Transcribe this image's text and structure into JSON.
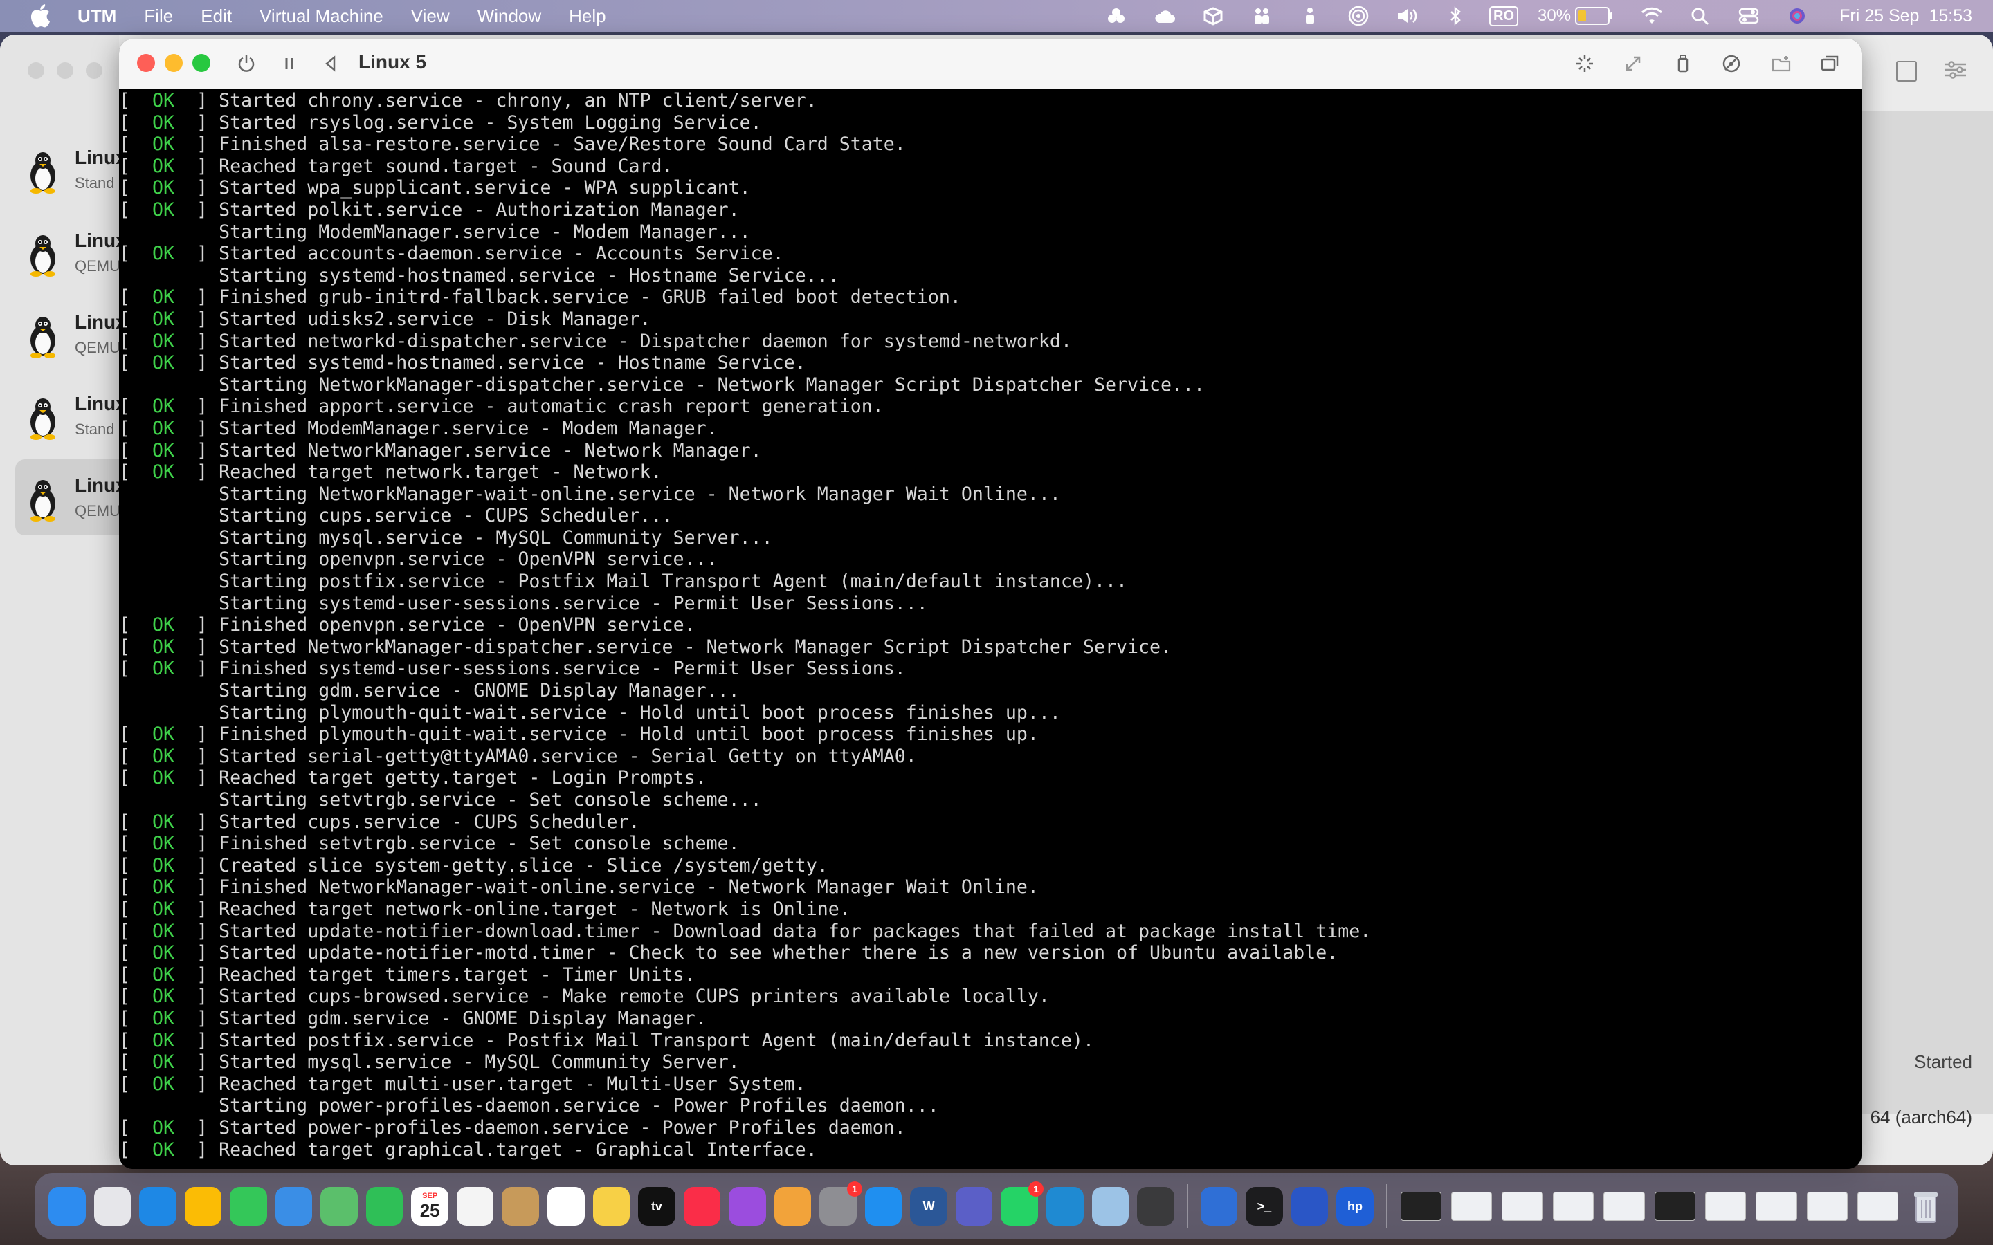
{
  "menubar": {
    "apple_icon": "apple-icon",
    "app_name": "UTM",
    "menus": [
      "File",
      "Edit",
      "Virtual Machine",
      "View",
      "Window",
      "Help"
    ],
    "input_source": "RO",
    "battery_percent": "30%",
    "battery_level": 0.3,
    "date": "Fri 25 Sep",
    "time": "15:53"
  },
  "library": {
    "vms": [
      {
        "name": "Linux",
        "subtitle": "Stand"
      },
      {
        "name": "Linux",
        "subtitle": "QEMU"
      },
      {
        "name": "Linux",
        "subtitle": "QEMU"
      },
      {
        "name": "Linux",
        "subtitle": "Stand"
      },
      {
        "name": "Linux",
        "subtitle": "QEMU"
      }
    ],
    "selected_index": 4,
    "status": "Started",
    "arch": "64 (aarch64)"
  },
  "vm_window": {
    "title": "Linux 5",
    "toolbar_icons": [
      "power-icon",
      "pause-icon",
      "back-icon",
      "capture-input-icon",
      "resize-icon",
      "usb-icon",
      "drive-icon",
      "shared-folder-icon",
      "windows-icon"
    ]
  },
  "console": {
    "lines": [
      {
        "ok": true,
        "text": "Started chrony.service - chrony, an NTP client/server."
      },
      {
        "ok": true,
        "text": "Started rsyslog.service - System Logging Service."
      },
      {
        "ok": true,
        "text": "Finished alsa-restore.service - Save/Restore Sound Card State."
      },
      {
        "ok": true,
        "text": "Reached target sound.target - Sound Card."
      },
      {
        "ok": true,
        "text": "Started wpa_supplicant.service - WPA supplicant."
      },
      {
        "ok": true,
        "text": "Started polkit.service - Authorization Manager."
      },
      {
        "ok": false,
        "text": "Starting ModemManager.service - Modem Manager..."
      },
      {
        "ok": true,
        "text": "Started accounts-daemon.service - Accounts Service."
      },
      {
        "ok": false,
        "text": "Starting systemd-hostnamed.service - Hostname Service..."
      },
      {
        "ok": true,
        "text": "Finished grub-initrd-fallback.service - GRUB failed boot detection."
      },
      {
        "ok": true,
        "text": "Started udisks2.service - Disk Manager."
      },
      {
        "ok": true,
        "text": "Started networkd-dispatcher.service - Dispatcher daemon for systemd-networkd."
      },
      {
        "ok": true,
        "text": "Started systemd-hostnamed.service - Hostname Service."
      },
      {
        "ok": false,
        "text": "Starting NetworkManager-dispatcher.service - Network Manager Script Dispatcher Service..."
      },
      {
        "ok": true,
        "text": "Finished apport.service - automatic crash report generation."
      },
      {
        "ok": true,
        "text": "Started ModemManager.service - Modem Manager."
      },
      {
        "ok": true,
        "text": "Started NetworkManager.service - Network Manager."
      },
      {
        "ok": true,
        "text": "Reached target network.target - Network."
      },
      {
        "ok": false,
        "text": "Starting NetworkManager-wait-online.service - Network Manager Wait Online..."
      },
      {
        "ok": false,
        "text": "Starting cups.service - CUPS Scheduler..."
      },
      {
        "ok": false,
        "text": "Starting mysql.service - MySQL Community Server..."
      },
      {
        "ok": false,
        "text": "Starting openvpn.service - OpenVPN service..."
      },
      {
        "ok": false,
        "text": "Starting postfix.service - Postfix Mail Transport Agent (main/default instance)..."
      },
      {
        "ok": false,
        "text": "Starting systemd-user-sessions.service - Permit User Sessions..."
      },
      {
        "ok": true,
        "text": "Finished openvpn.service - OpenVPN service."
      },
      {
        "ok": true,
        "text": "Started NetworkManager-dispatcher.service - Network Manager Script Dispatcher Service."
      },
      {
        "ok": true,
        "text": "Finished systemd-user-sessions.service - Permit User Sessions."
      },
      {
        "ok": false,
        "text": "Starting gdm.service - GNOME Display Manager..."
      },
      {
        "ok": false,
        "text": "Starting plymouth-quit-wait.service - Hold until boot process finishes up..."
      },
      {
        "ok": true,
        "text": "Finished plymouth-quit-wait.service - Hold until boot process finishes up."
      },
      {
        "ok": true,
        "text": "Started serial-getty@ttyAMA0.service - Serial Getty on ttyAMA0."
      },
      {
        "ok": true,
        "text": "Reached target getty.target - Login Prompts."
      },
      {
        "ok": false,
        "text": "Starting setvtrgb.service - Set console scheme..."
      },
      {
        "ok": true,
        "text": "Started cups.service - CUPS Scheduler."
      },
      {
        "ok": true,
        "text": "Finished setvtrgb.service - Set console scheme."
      },
      {
        "ok": true,
        "text": "Created slice system-getty.slice - Slice /system/getty."
      },
      {
        "ok": true,
        "text": "Finished NetworkManager-wait-online.service - Network Manager Wait Online."
      },
      {
        "ok": true,
        "text": "Reached target network-online.target - Network is Online."
      },
      {
        "ok": true,
        "text": "Started update-notifier-download.timer - Download data for packages that failed at package install time."
      },
      {
        "ok": true,
        "text": "Started update-notifier-motd.timer - Check to see whether there is a new version of Ubuntu available."
      },
      {
        "ok": true,
        "text": "Reached target timers.target - Timer Units."
      },
      {
        "ok": true,
        "text": "Started cups-browsed.service - Make remote CUPS printers available locally."
      },
      {
        "ok": true,
        "text": "Started gdm.service - GNOME Display Manager."
      },
      {
        "ok": true,
        "text": "Started postfix.service - Postfix Mail Transport Agent (main/default instance)."
      },
      {
        "ok": true,
        "text": "Started mysql.service - MySQL Community Server."
      },
      {
        "ok": true,
        "text": "Reached target multi-user.target - Multi-User System."
      },
      {
        "ok": false,
        "text": "Starting power-profiles-daemon.service - Power Profiles daemon..."
      },
      {
        "ok": true,
        "text": "Started power-profiles-daemon.service - Power Profiles daemon."
      },
      {
        "ok": true,
        "text": "Reached target graphical.target - Graphical Interface."
      }
    ]
  },
  "dock": {
    "apps": [
      {
        "name": "finder-icon",
        "color": "#2d8cf0",
        "label": ""
      },
      {
        "name": "launchpad-icon",
        "color": "#e6e6ea",
        "label": ""
      },
      {
        "name": "safari-icon",
        "color": "#1e88e5",
        "label": ""
      },
      {
        "name": "chrome-icon",
        "color": "#fbbc05",
        "label": ""
      },
      {
        "name": "messages-icon",
        "color": "#34c759",
        "label": ""
      },
      {
        "name": "mail-icon",
        "color": "#3a8ee6",
        "label": ""
      },
      {
        "name": "maps-icon",
        "color": "#5bbf6b",
        "label": ""
      },
      {
        "name": "facetime-icon",
        "color": "#2fbf57",
        "label": ""
      },
      {
        "name": "calendar-icon",
        "color": "#ffffff",
        "label": "25",
        "month": "SEP"
      },
      {
        "name": "freeform-icon",
        "color": "#f4f4f4",
        "label": ""
      },
      {
        "name": "contacts-icon",
        "color": "#c79a5a",
        "label": ""
      },
      {
        "name": "reminders-icon",
        "color": "#ffffff",
        "label": ""
      },
      {
        "name": "notes-icon",
        "color": "#f7d046",
        "label": ""
      },
      {
        "name": "appletv-icon",
        "color": "#111111",
        "label": "tv"
      },
      {
        "name": "music-icon",
        "color": "#fa2d48",
        "label": ""
      },
      {
        "name": "podcasts-icon",
        "color": "#9b4dde",
        "label": ""
      },
      {
        "name": "photos-icon",
        "color": "#f2a33a",
        "label": ""
      },
      {
        "name": "system-settings-icon",
        "color": "#8e8e93",
        "label": "",
        "badge": "1"
      },
      {
        "name": "app-store-icon",
        "color": "#1f8ff0",
        "label": ""
      },
      {
        "name": "word-icon",
        "color": "#2b5797",
        "label": "W"
      },
      {
        "name": "teams-icon",
        "color": "#5b5fc7",
        "label": ""
      },
      {
        "name": "whatsapp-icon",
        "color": "#25d366",
        "label": "",
        "badge": "1"
      },
      {
        "name": "vscode-icon",
        "color": "#1f8ad2",
        "label": ""
      },
      {
        "name": "preview-icon",
        "color": "#9cc3e6",
        "label": ""
      },
      {
        "name": "screenshot-icon",
        "color": "#3a3a3c",
        "label": ""
      }
    ],
    "apps2": [
      {
        "name": "utm-icon",
        "color": "#2f6fd6",
        "label": ""
      },
      {
        "name": "terminal-icon",
        "color": "#1c1c1e",
        "label": ">_"
      },
      {
        "name": "activity-icon",
        "color": "#2a56c6",
        "label": ""
      },
      {
        "name": "hp-icon",
        "color": "#1f5fd6",
        "label": "hp"
      }
    ],
    "trash": "trash-icon"
  }
}
